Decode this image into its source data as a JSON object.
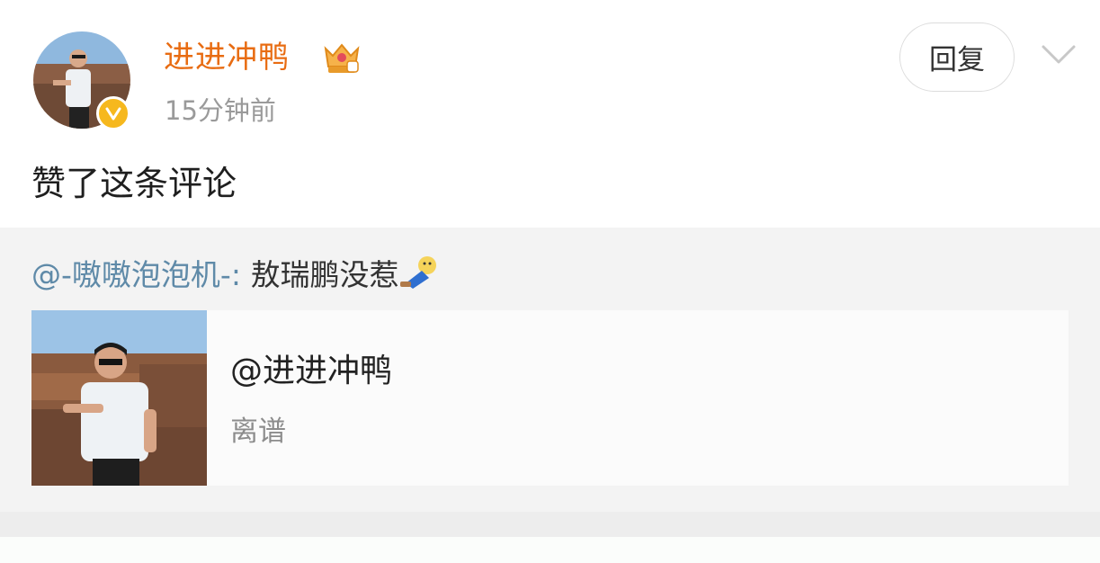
{
  "post": {
    "username": "进进冲鸭",
    "time": "15分钟前",
    "reply_label": "回复",
    "text": "赞了这条评论",
    "icons": {
      "verified": "verified-badge-icon",
      "crown": "vip-crown-icon",
      "more": "chevron-down-icon"
    }
  },
  "quoted": {
    "mention": "@-嗷嗷泡泡机-:",
    "text": "敖瑞鹏没惹",
    "emoji": "pointing-doll-emoji",
    "card": {
      "title": "@进进冲鸭",
      "subtitle": "离谱"
    }
  },
  "colors": {
    "username": "#e86c12",
    "mention": "#5f8aa8",
    "quoted_bg": "#f3f3f3",
    "verified": "#f6b81e"
  }
}
